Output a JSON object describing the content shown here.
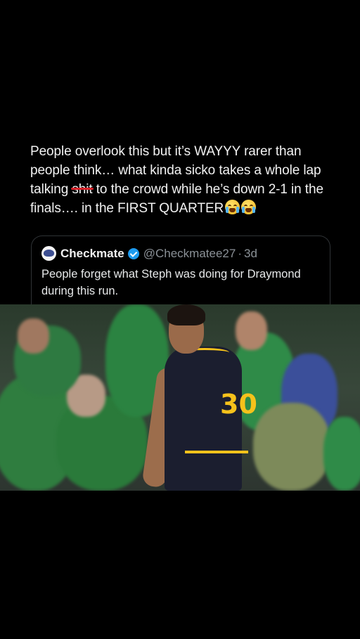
{
  "post": {
    "text_part1": "People overlook this but it’s WAYYY rarer than people think… what kinda sicko takes a whole lap talking ",
    "censored_word": "shit",
    "text_part2": " to the crowd while he’s down 2-1 in the finals…. in the FIRST QUARTER",
    "emojis": [
      "loudly-crying-face-icon",
      "loudly-crying-face-icon"
    ]
  },
  "quoted_post": {
    "display_name": "Checkmate",
    "handle": "@Checkmatee27",
    "separator": "·",
    "time": "3d",
    "text": "People forget what Steph was doing for Draymond during this run.",
    "verified": true
  },
  "video": {
    "jersey_number": "30",
    "colors": {
      "crowd_green": "#2f7d3f",
      "jersey_navy": "#1b1e2f",
      "jersey_gold": "#f6c21b"
    }
  },
  "colors": {
    "background": "#000000",
    "text": "#f2f2f2",
    "muted": "#8b9197",
    "verified": "#1d9bf0",
    "censor_line": "#d8232a"
  }
}
